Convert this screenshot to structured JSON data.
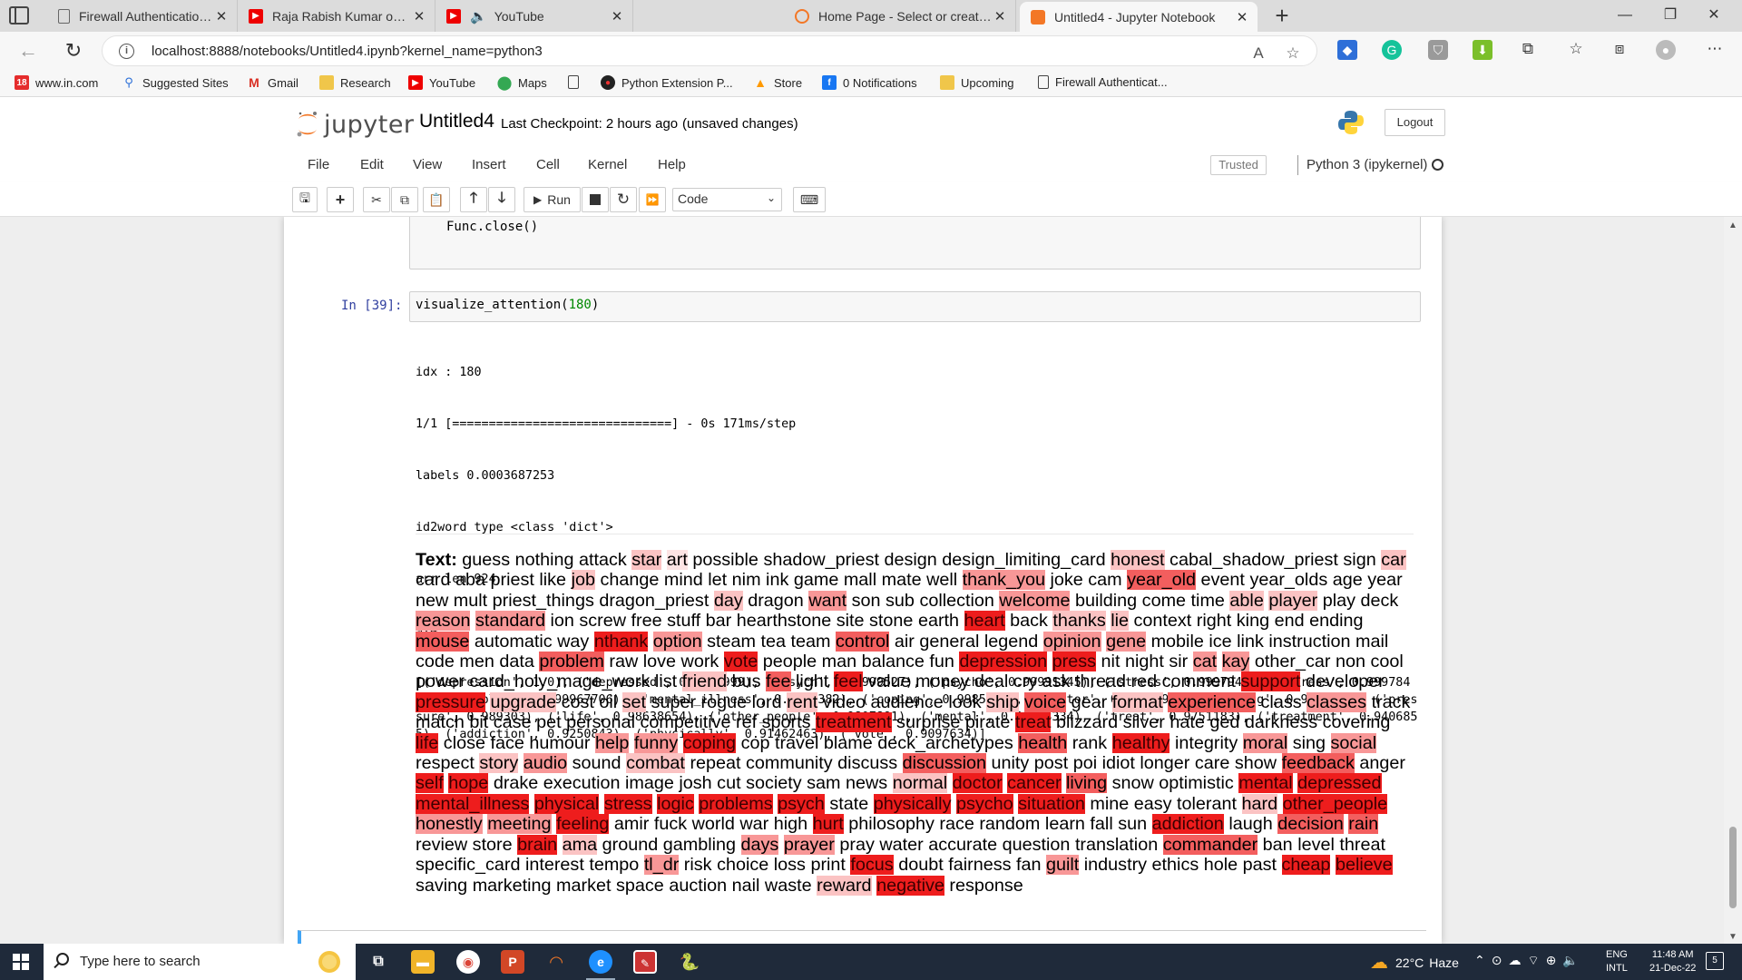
{
  "browser": {
    "tabs": [
      {
        "title": "Firewall Authentication Keepalive",
        "icon": "doc-icon"
      },
      {
        "title": "Raja Rabish Kumar on Ravish Kumar",
        "icon": "youtube-icon"
      },
      {
        "title": "YouTube",
        "icon": "youtube-icon"
      },
      {
        "title": "Home Page - Select or create a notebook",
        "icon": "jupyter-icon"
      },
      {
        "title": "Untitled4 - Jupyter Notebook",
        "icon": "jupyter-icon"
      }
    ],
    "url": "localhost:8888/notebooks/Untitled4.ipynb?kernel_name=python3",
    "favorites": [
      {
        "label": "www.in.com",
        "icon": "in-com-icon"
      },
      {
        "label": "Suggested Sites",
        "icon": "suggested-sites-icon"
      },
      {
        "label": "Gmail",
        "icon": "gmail-icon"
      },
      {
        "label": "Research",
        "icon": "folder-icon"
      },
      {
        "label": "YouTube",
        "icon": "youtube-icon"
      },
      {
        "label": "Maps",
        "icon": "maps-icon"
      },
      {
        "label": "",
        "icon": "doc-icon"
      },
      {
        "label": "Python Extension P...",
        "icon": "python-ext-icon"
      },
      {
        "label": "Store",
        "icon": "store-icon"
      },
      {
        "label": "0 Notifications",
        "icon": "facebook-icon"
      },
      {
        "label": "Upcoming",
        "icon": "folder-icon"
      },
      {
        "label": "Firewall Authenticat...",
        "icon": "doc-icon"
      }
    ]
  },
  "jupyter": {
    "logo_text": "jupyter",
    "notebook_name": "Untitled4",
    "checkpoint": "Last Checkpoint: 2 hours ago",
    "unsaved": "(unsaved changes)",
    "logout": "Logout",
    "menu": [
      "File",
      "Edit",
      "View",
      "Insert",
      "Cell",
      "Kernel",
      "Help"
    ],
    "trusted": "Trusted",
    "kernel": "Python 3 (ipykernel)",
    "toolbar": {
      "run_label": "Run",
      "cell_type": "Code"
    }
  },
  "notebook": {
    "prev_cell_code": "Func.close()",
    "prompt": "In [39]:",
    "code_func": "visualize_attention(",
    "code_arg": "180",
    "code_close": ")",
    "output_lines": [
      "idx : 180",
      "1/1 [==============================] - 0s 171ms/step",
      "labels 0.0003687253",
      "id2word type <class 'dict'>",
      "arr len 924",
      "924",
      "[('depression', 1.0), ('depressed', 0.9999999), ('psych', 0.9999527), ('psycho', 0.99991345), ('stress', 0.99979454), ('press', 0.9997849), ('problems', 0.99967706), ('mental_illness', 0.9994382), ('coping', 0.9985297), ('doctor', 0.9960295), ('feeling', 0.9929443), ('pressure', 0.989303), ('life', 0.98638654), ('other_people', 0.9807891), ('mental', 0.98003334), ('treat', 0.9751183), ('treatment', 0.9406855), ('addiction', 0.9250843), ('physically', 0.91462463), ('vote', 0.9097634)]"
    ],
    "attention_label": "Text:",
    "attention_words": [
      [
        "guess",
        0
      ],
      [
        "nothing",
        0
      ],
      [
        "attack",
        0
      ],
      [
        "star",
        2
      ],
      [
        "art",
        1
      ],
      [
        "possible",
        0
      ],
      [
        "shadow_priest",
        0
      ],
      [
        "design",
        0
      ],
      [
        "design_limiting_card",
        0
      ],
      [
        "honest",
        2
      ],
      [
        "cabal_shadow_priest",
        0
      ],
      [
        "sign",
        0
      ],
      [
        "car",
        2
      ],
      [
        "card",
        0
      ],
      [
        "aba",
        0
      ],
      [
        "priest",
        0
      ],
      [
        "like",
        0
      ],
      [
        "job",
        2
      ],
      [
        "change",
        0
      ],
      [
        "mind",
        0
      ],
      [
        "let",
        0
      ],
      [
        "nim",
        0
      ],
      [
        "ink",
        0
      ],
      [
        "game",
        0
      ],
      [
        "mall",
        0
      ],
      [
        "mate",
        0
      ],
      [
        "well",
        0
      ],
      [
        "thank_you",
        3
      ],
      [
        "joke",
        0
      ],
      [
        "cam",
        0
      ],
      [
        "year_old",
        4
      ],
      [
        "event",
        0
      ],
      [
        "year_olds",
        0
      ],
      [
        "age",
        0
      ],
      [
        "year",
        0
      ],
      [
        "new",
        0
      ],
      [
        "mult",
        0
      ],
      [
        "priest_things",
        0
      ],
      [
        "dragon_priest",
        0
      ],
      [
        "day",
        2
      ],
      [
        "dragon",
        0
      ],
      [
        "want",
        3
      ],
      [
        "son",
        0
      ],
      [
        "sub",
        0
      ],
      [
        "collection",
        0
      ],
      [
        "welcome",
        3
      ],
      [
        "building",
        0
      ],
      [
        "come",
        0
      ],
      [
        "time",
        0
      ],
      [
        "able",
        2
      ],
      [
        "player",
        2
      ],
      [
        "play",
        0
      ],
      [
        "deck",
        0
      ],
      [
        "reason",
        3
      ],
      [
        "standard",
        3
      ],
      [
        "ion",
        0
      ],
      [
        "screw",
        0
      ],
      [
        "free",
        0
      ],
      [
        "stuff",
        0
      ],
      [
        "bar",
        0
      ],
      [
        "hearthstone",
        0
      ],
      [
        "site",
        0
      ],
      [
        "stone",
        0
      ],
      [
        "earth",
        0
      ],
      [
        "heart",
        5
      ],
      [
        "back",
        0
      ],
      [
        "thanks",
        2
      ],
      [
        "lie",
        2
      ],
      [
        "context",
        0
      ],
      [
        "right",
        0
      ],
      [
        "king",
        0
      ],
      [
        "end",
        0
      ],
      [
        "ending",
        0
      ],
      [
        "mouse",
        4
      ],
      [
        "automatic",
        0
      ],
      [
        "way",
        0
      ],
      [
        "nthank",
        5
      ],
      [
        "option",
        3
      ],
      [
        "steam",
        0
      ],
      [
        "tea",
        0
      ],
      [
        "team",
        0
      ],
      [
        "control",
        4
      ],
      [
        "air",
        0
      ],
      [
        "general",
        0
      ],
      [
        "legend",
        0
      ],
      [
        "opinion",
        3
      ],
      [
        "gene",
        3
      ],
      [
        "mobile",
        0
      ],
      [
        "ice",
        0
      ],
      [
        "link",
        0
      ],
      [
        "instruction",
        0
      ],
      [
        "mail",
        0
      ],
      [
        "code",
        0
      ],
      [
        "men",
        0
      ],
      [
        "data",
        0
      ],
      [
        "problem",
        4
      ],
      [
        "raw",
        0
      ],
      [
        "love",
        0
      ],
      [
        "work",
        0
      ],
      [
        "vote",
        5
      ],
      [
        "people",
        0
      ],
      [
        "man",
        0
      ],
      [
        "balance",
        0
      ],
      [
        "fun",
        0
      ],
      [
        "depression",
        5
      ],
      [
        "press",
        5
      ],
      [
        "nit",
        0
      ],
      [
        "night",
        0
      ],
      [
        "sir",
        0
      ],
      [
        "cat",
        3
      ],
      [
        "kay",
        3
      ],
      [
        "other_car",
        0
      ],
      [
        "non",
        0
      ],
      [
        "cool",
        0
      ],
      [
        "power",
        0
      ],
      [
        "card_holy_mage_work",
        0
      ],
      [
        "list",
        0
      ],
      [
        "friend",
        2
      ],
      [
        "bus",
        0
      ],
      [
        "fee",
        4
      ],
      [
        "light",
        0
      ],
      [
        "feel",
        5
      ],
      [
        "value",
        0
      ],
      [
        "money",
        0
      ],
      [
        "deal",
        0
      ],
      [
        "cry",
        0
      ],
      [
        "ask",
        0
      ],
      [
        "thread",
        0
      ],
      [
        "red",
        0
      ],
      [
        "comment",
        0
      ],
      [
        "support",
        5
      ],
      [
        "developer",
        0
      ],
      [
        "pressure",
        5
      ],
      [
        "upgrade",
        2
      ],
      [
        "cost",
        0
      ],
      [
        "oil",
        0
      ],
      [
        "set",
        2
      ],
      [
        "super",
        0
      ],
      [
        "rogue",
        0
      ],
      [
        "lord",
        0
      ],
      [
        "rent",
        2
      ],
      [
        "video",
        0
      ],
      [
        "audience",
        0
      ],
      [
        "look",
        0
      ],
      [
        "ship",
        2
      ],
      [
        "voice",
        4
      ],
      [
        "gear",
        0
      ],
      [
        "format",
        2
      ],
      [
        "experience",
        4
      ],
      [
        "class",
        0
      ],
      [
        "classes",
        3
      ],
      [
        "track",
        0
      ],
      [
        "match",
        0
      ],
      [
        "bit",
        0
      ],
      [
        "case",
        0
      ],
      [
        "pet",
        0
      ],
      [
        "personal",
        0
      ],
      [
        "competitive",
        0
      ],
      [
        "ref",
        0
      ],
      [
        "sports",
        0
      ],
      [
        "treatment",
        5
      ],
      [
        "surprise",
        0
      ],
      [
        "pirate",
        0
      ],
      [
        "treat",
        5
      ],
      [
        "blizzard",
        0
      ],
      [
        "silver",
        0
      ],
      [
        "hate",
        0
      ],
      [
        "ged",
        0
      ],
      [
        "darkness",
        0
      ],
      [
        "covering",
        0
      ],
      [
        "life",
        5
      ],
      [
        "close",
        0
      ],
      [
        "face",
        0
      ],
      [
        "humour",
        0
      ],
      [
        "help",
        3
      ],
      [
        "funny",
        3
      ],
      [
        "coping",
        5
      ],
      [
        "cop",
        0
      ],
      [
        "travel",
        0
      ],
      [
        "blame",
        0
      ],
      [
        "deck_archetypes",
        0
      ],
      [
        "health",
        4
      ],
      [
        "rank",
        0
      ],
      [
        "healthy",
        5
      ],
      [
        "integrity",
        0
      ],
      [
        "moral",
        3
      ],
      [
        "sing",
        0
      ],
      [
        "social",
        3
      ],
      [
        "respect",
        0
      ],
      [
        "story",
        2
      ],
      [
        "audio",
        3
      ],
      [
        "sound",
        0
      ],
      [
        "combat",
        2
      ],
      [
        "repeat",
        0
      ],
      [
        "community",
        0
      ],
      [
        "discuss",
        0
      ],
      [
        "discussion",
        4
      ],
      [
        "unity",
        0
      ],
      [
        "post",
        0
      ],
      [
        "poi",
        0
      ],
      [
        "idiot",
        0
      ],
      [
        "longer",
        0
      ],
      [
        "care",
        0
      ],
      [
        "show",
        0
      ],
      [
        "feedback",
        4
      ],
      [
        "anger",
        0
      ],
      [
        "self",
        5
      ],
      [
        "hope",
        5
      ],
      [
        "drake",
        0
      ],
      [
        "execution",
        0
      ],
      [
        "image",
        0
      ],
      [
        "josh",
        0
      ],
      [
        "cut",
        0
      ],
      [
        "society",
        0
      ],
      [
        "sam",
        0
      ],
      [
        "news",
        0
      ],
      [
        "normal",
        2
      ],
      [
        "doctor",
        5
      ],
      [
        "cancer",
        5
      ],
      [
        "living",
        4
      ],
      [
        "snow",
        0
      ],
      [
        "optimistic",
        0
      ],
      [
        "mental",
        5
      ],
      [
        "depressed",
        5
      ],
      [
        "mental_illness",
        5
      ],
      [
        "physical",
        5
      ],
      [
        "stress",
        5
      ],
      [
        "logic",
        5
      ],
      [
        "problems",
        5
      ],
      [
        "psych",
        5
      ],
      [
        "state",
        0
      ],
      [
        "physically",
        5
      ],
      [
        "psycho",
        5
      ],
      [
        "situation",
        5
      ],
      [
        "mine",
        0
      ],
      [
        "easy",
        0
      ],
      [
        "tolerant",
        0
      ],
      [
        "hard",
        2
      ],
      [
        "other_people",
        5
      ],
      [
        "honestly",
        3
      ],
      [
        "meeting",
        3
      ],
      [
        "feeling",
        5
      ],
      [
        "amir",
        0
      ],
      [
        "fuck",
        0
      ],
      [
        "world",
        0
      ],
      [
        "war",
        0
      ],
      [
        "high",
        0
      ],
      [
        "hurt",
        5
      ],
      [
        "philosophy",
        0
      ],
      [
        "race",
        0
      ],
      [
        "random",
        0
      ],
      [
        "learn",
        0
      ],
      [
        "fall",
        0
      ],
      [
        "sun",
        0
      ],
      [
        "addiction",
        5
      ],
      [
        "laugh",
        0
      ],
      [
        "decision",
        4
      ],
      [
        "rain",
        4
      ],
      [
        "review",
        0
      ],
      [
        "store",
        0
      ],
      [
        "brain",
        5
      ],
      [
        "ama",
        2
      ],
      [
        "ground",
        0
      ],
      [
        "gambling",
        0
      ],
      [
        "days",
        3
      ],
      [
        "prayer",
        3
      ],
      [
        "pray",
        0
      ],
      [
        "water",
        0
      ],
      [
        "accurate",
        0
      ],
      [
        "question",
        0
      ],
      [
        "translation",
        0
      ],
      [
        "commander",
        4
      ],
      [
        "ban",
        0
      ],
      [
        "level",
        0
      ],
      [
        "threat",
        0
      ],
      [
        "specific_card",
        0
      ],
      [
        "interest",
        0
      ],
      [
        "tempo",
        0
      ],
      [
        "tl_dr",
        3
      ],
      [
        "risk",
        0
      ],
      [
        "choice",
        0
      ],
      [
        "loss",
        0
      ],
      [
        "print",
        0
      ],
      [
        "focus",
        5
      ],
      [
        "doubt",
        0
      ],
      [
        "fairness",
        0
      ],
      [
        "fan",
        0
      ],
      [
        "guilt",
        3
      ],
      [
        "industry",
        0
      ],
      [
        "ethics",
        0
      ],
      [
        "hole",
        0
      ],
      [
        "past",
        0
      ],
      [
        "cheap",
        5
      ],
      [
        "believe",
        5
      ],
      [
        "saving",
        0
      ],
      [
        "marketing",
        0
      ],
      [
        "market",
        0
      ],
      [
        "space",
        0
      ],
      [
        "auction",
        0
      ],
      [
        "nail",
        0
      ],
      [
        "waste",
        0
      ],
      [
        "reward",
        2
      ],
      [
        "negative",
        5
      ],
      [
        "response",
        0
      ]
    ],
    "attention_colors": [
      "transparent",
      "#fde4e4",
      "#fbc3c3",
      "#f89797",
      "#f35e5e",
      "#ee1d1d"
    ]
  },
  "taskbar": {
    "search_placeholder": "Type here to search",
    "weather_temp": "22°C",
    "weather_desc": "Haze",
    "lang_1": "ENG",
    "lang_2": "INTL",
    "time": "11:48 AM",
    "date": "21-Dec-22",
    "notif_count": "5"
  }
}
